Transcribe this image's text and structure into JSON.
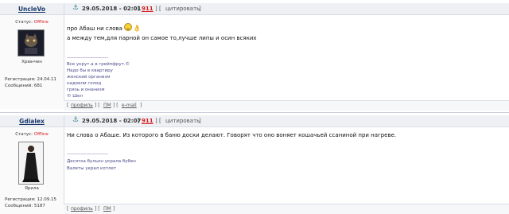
{
  "posts": [
    {
      "author": "UncleVo",
      "status_label": "Статус:",
      "status_value": "Offline",
      "avatar_caption": "Хрюнчен",
      "reg_label": "Регистрация:",
      "reg_date": "24.04.11",
      "msgs_label": "Сообщений:",
      "msgs_count": "681",
      "date": "29.05.2018 - 02:01",
      "post_number": "911",
      "quote_label": "цитировать",
      "lines": [
        "про Абаш ни слова",
        "а между тем,для парной он самое то,лучше липы и осин всяких"
      ],
      "sig_separator": "------------------------",
      "sig_lines": [
        "Все укрут.а в грейпфрут.©",
        "Надо бы в квартиру",
        "женский организм",
        "надоели голод",
        "грязь и онанизм",
        "© Шел"
      ],
      "footer_links": [
        "профиль",
        "ПМ",
        "e-mail"
      ]
    },
    {
      "author": "Gdialex",
      "status_label": "Статус:",
      "status_value": "Offline",
      "avatar_caption": "Ярила",
      "reg_label": "Регистрация:",
      "reg_date": "12.09.15",
      "msgs_label": "Сообщений:",
      "msgs_count": "5187",
      "date": "29.05.2018 - 02:07",
      "post_number": "911",
      "quote_label": "цитировать",
      "lines": [
        "Ни слова о Абаше. Из которого в баню доски делают. Говорят что оно воняет кошачьей ссаниной при нагреве."
      ],
      "sig_separator": "------------------------",
      "sig_lines": [
        "Десятка бульон украла бубен",
        "Валеты украл котлет"
      ],
      "footer_links": [
        "профиль",
        "ПМ"
      ]
    }
  ]
}
